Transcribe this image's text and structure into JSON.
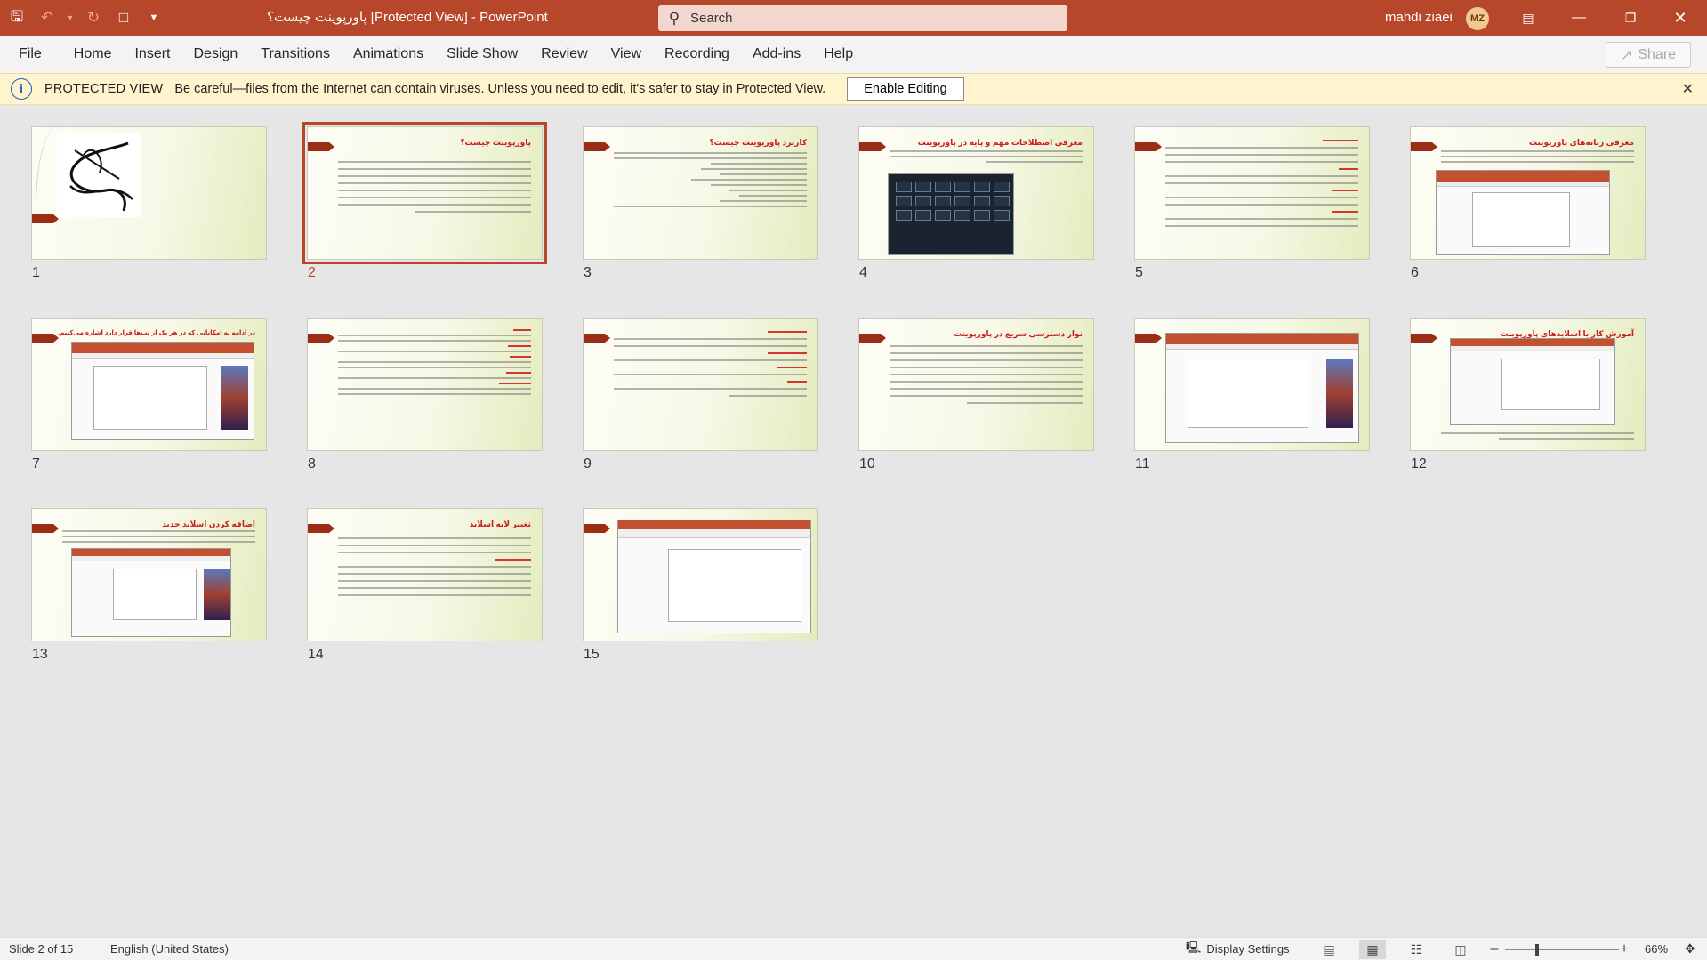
{
  "app": {
    "title": "پاورپوینت چیست؟  [Protected View]  -  PowerPoint",
    "search_placeholder": "Search",
    "user_name": "mahdi ziaei",
    "user_initials": "MZ",
    "accent_color": "#b7472a"
  },
  "ribbon": {
    "tabs": [
      "File",
      "Home",
      "Insert",
      "Design",
      "Transitions",
      "Animations",
      "Slide Show",
      "Review",
      "View",
      "Recording",
      "Add-ins",
      "Help"
    ],
    "share_label": "Share"
  },
  "protected_view": {
    "label": "PROTECTED VIEW",
    "message": "Be careful—files from the Internet can contain viruses. Unless you need to edit, it's safer to stay in Protected View.",
    "button": "Enable Editing"
  },
  "slides": [
    {
      "number": "1",
      "title": "",
      "selected": false
    },
    {
      "number": "2",
      "title": "پاورپوینت چیست؟",
      "selected": true
    },
    {
      "number": "3",
      "title": "کاربرد پاورپوینت چیست؟",
      "selected": false
    },
    {
      "number": "4",
      "title": "معرفی اصطلاحات مهم و پایه در پاورپوینت",
      "selected": false
    },
    {
      "number": "5",
      "title": "",
      "selected": false
    },
    {
      "number": "6",
      "title": "معرفی زبانه‌های پاورپوینت",
      "selected": false
    },
    {
      "number": "7",
      "title": "در ادامه به امکاناتی که در هر یک از تب‌ها قرار دارد اشاره می‌کنیم.",
      "selected": false
    },
    {
      "number": "8",
      "title": "",
      "selected": false
    },
    {
      "number": "9",
      "title": "",
      "selected": false
    },
    {
      "number": "10",
      "title": "نوار دسترسی سریع در پاورپوینت",
      "selected": false
    },
    {
      "number": "11",
      "title": "",
      "selected": false
    },
    {
      "number": "12",
      "title": "آموزش کار با اسلایدهای پاورپوینت",
      "selected": false
    },
    {
      "number": "13",
      "title": "اضافه کردن اسلاید جدید",
      "selected": false
    },
    {
      "number": "14",
      "title": "تغییر لایه اسلاید",
      "selected": false
    },
    {
      "number": "15",
      "title": "",
      "selected": false
    }
  ],
  "status": {
    "slide_info": "Slide 2 of 15",
    "language": "English (United States)",
    "display_settings": "Display Settings",
    "zoom": "66%"
  }
}
